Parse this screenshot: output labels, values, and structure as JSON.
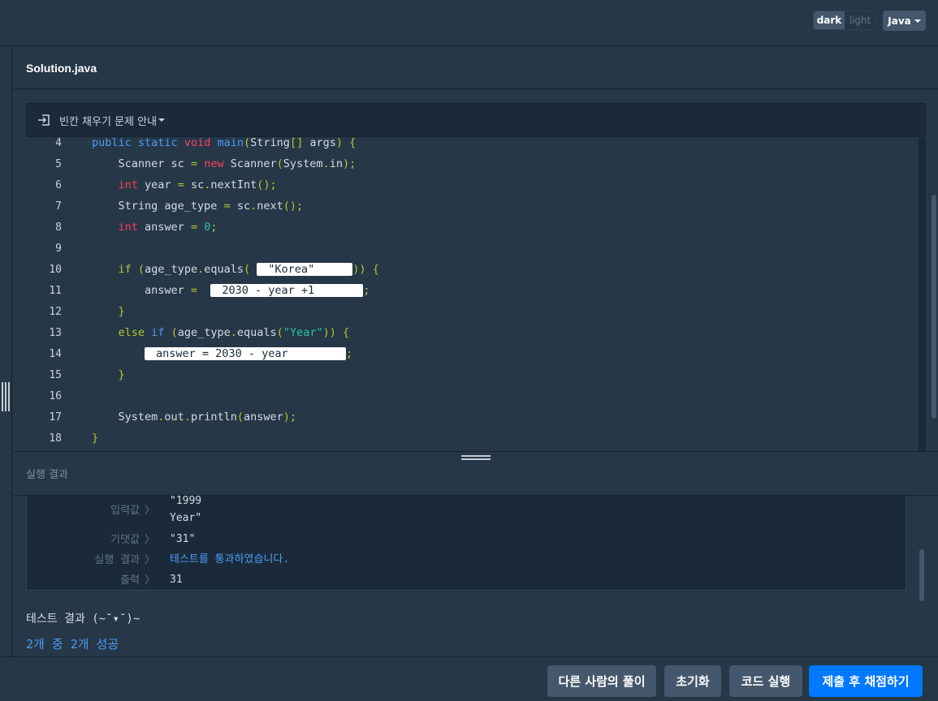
{
  "topbar": {
    "theme_dark": "dark",
    "theme_light": "light",
    "language": "Java"
  },
  "editor": {
    "file_name": "Solution.java",
    "guide_label": "빈칸 채우기 문제 안내",
    "lines": [
      {
        "n": "4"
      },
      {
        "n": "5"
      },
      {
        "n": "6"
      },
      {
        "n": "7"
      },
      {
        "n": "8"
      },
      {
        "n": "9"
      },
      {
        "n": "10"
      },
      {
        "n": "11"
      },
      {
        "n": "12"
      },
      {
        "n": "13"
      },
      {
        "n": "14"
      },
      {
        "n": "15"
      },
      {
        "n": "16"
      },
      {
        "n": "17"
      },
      {
        "n": "18"
      }
    ],
    "blanks": {
      "blank1": "\"Korea\"",
      "blank2": "2030 - year +1",
      "blank3": "answer = 2030 - year"
    }
  },
  "result": {
    "title": "실행 결과",
    "input_label": "입력값",
    "input_value": "\"1999\nYear\"",
    "expected_label": "기댓값",
    "expected_value": "\"31\"",
    "run_label": "실행 결과",
    "run_value": "테스트를 통과하였습니다.",
    "output_label": "출력",
    "output_value": "31",
    "arrow": "〉",
    "summary": "테스트 결과 (~˘▾˘)~",
    "count": "2개 중 2개 성공"
  },
  "buttons": {
    "other_solutions": "다른 사람의 풀이",
    "reset": "초기화",
    "run_code": "코드 실행",
    "submit": "제출 후 채점하기"
  },
  "colors": {
    "background": "#263747",
    "panel": "#1b2a3a",
    "primary": "#0078ff",
    "pass": "#4d9af5"
  }
}
